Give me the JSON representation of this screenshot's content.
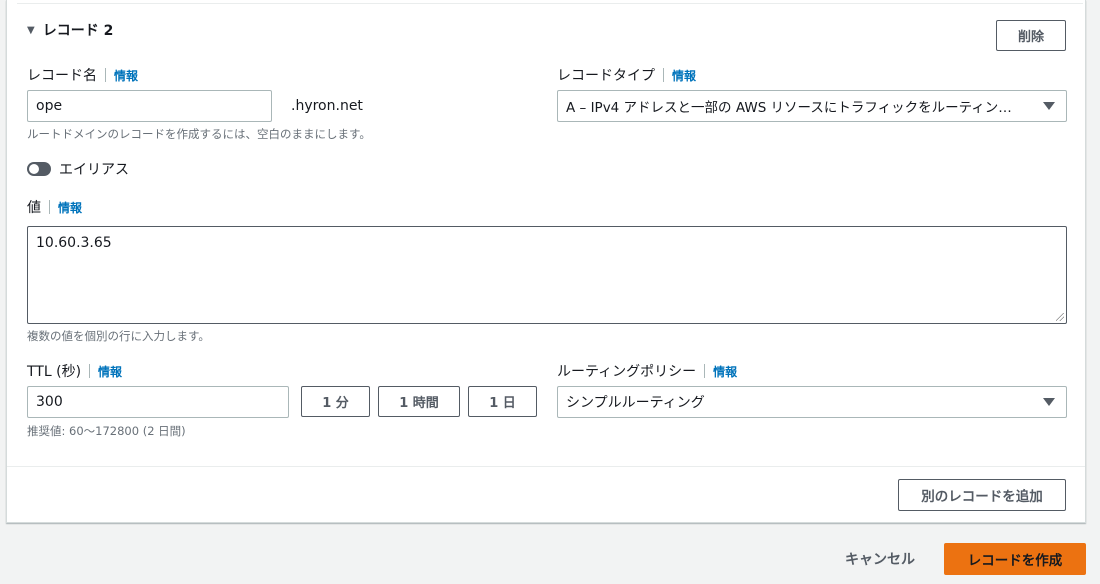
{
  "record": {
    "header": "レコード 2",
    "delete_label": "削除",
    "name_label": "レコード名",
    "info_label": "情報",
    "name_value": "ope",
    "domain_suffix": ".hyron.net",
    "name_hint": "ルートドメインのレコードを作成するには、空白のままにします。",
    "type_label": "レコードタイプ",
    "type_value": "A – IPv4 アドレスと一部の AWS リソースにトラフィックをルーティン…",
    "alias_label": "エイリアス",
    "value_label": "値",
    "value_text": "10.60.3.65",
    "value_hint": "複数の値を個別の行に入力します。",
    "ttl_label": "TTL (秒)",
    "ttl_value": "300",
    "ttl_1min": "1 分",
    "ttl_1hour": "1 時間",
    "ttl_1day": "1 日",
    "ttl_hint": "推奨値: 60～172800 (2 日間)",
    "policy_label": "ルーティングポリシー",
    "policy_value": "シンプルルーティング"
  },
  "footer": {
    "add_record_label": "別のレコードを追加",
    "cancel_label": "キャンセル",
    "create_label": "レコードを作成"
  },
  "colors": {
    "primary": "#ec7211",
    "link": "#0073bb"
  }
}
